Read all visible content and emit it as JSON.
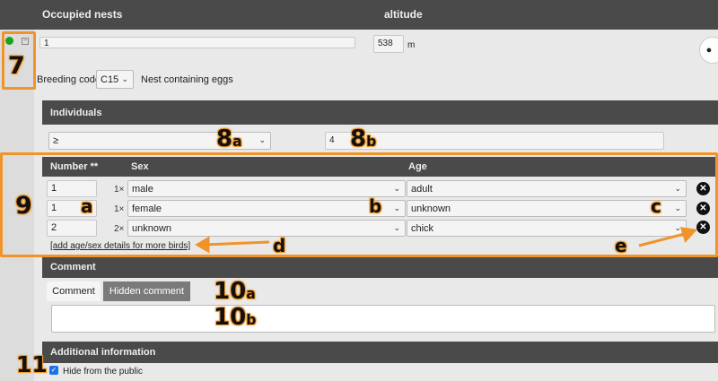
{
  "header": {
    "occupied_nests": "Occupied nests",
    "altitude": "altitude"
  },
  "nest": {
    "count_value": "1",
    "altitude_value": "538",
    "altitude_unit": "m"
  },
  "breeding": {
    "label": "Breeding code",
    "code": "C15",
    "description": "Nest containing eggs"
  },
  "individuals": {
    "title": "Individuals",
    "operator": "≥",
    "count": "4"
  },
  "table": {
    "headers": {
      "number": "Number **",
      "sex": "Sex",
      "age": "Age"
    },
    "rows": [
      {
        "number": "1",
        "mult": "1×",
        "sex": "male",
        "age": "adult"
      },
      {
        "number": "1",
        "mult": "1×",
        "sex": "female",
        "age": "unknown"
      },
      {
        "number": "2",
        "mult": "2×",
        "sex": "unknown",
        "age": "chick"
      }
    ],
    "add_link": "[add age/sex details for more birds]"
  },
  "comment": {
    "title": "Comment",
    "tab_comment": "Comment",
    "tab_hidden": "Hidden comment"
  },
  "additional": {
    "title": "Additional information",
    "hide_label": "Hide from the public"
  },
  "annotations": {
    "n7": "7",
    "n8": "8",
    "a": "a",
    "b": "b",
    "n9": "9",
    "c": "c",
    "d": "d",
    "e": "e",
    "n10": "10",
    "n11": "11"
  },
  "colors": {
    "header_bg": "#4a4a4a",
    "accent": "#f0942a",
    "status": "#1aa31a"
  }
}
